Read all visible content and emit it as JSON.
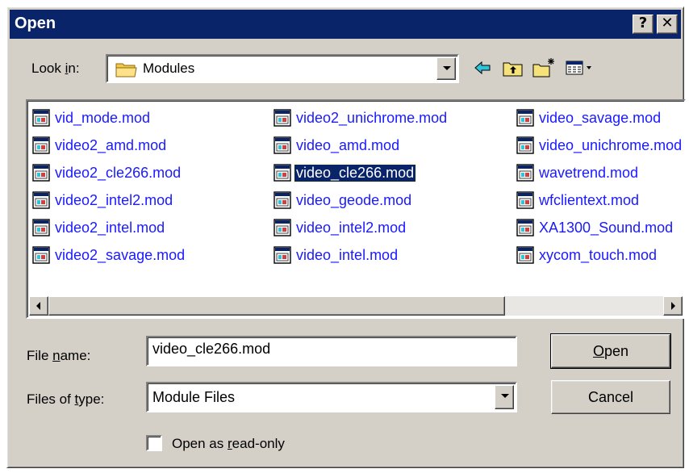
{
  "window": {
    "title": "Open",
    "help_label": "?",
    "close_label": "✕"
  },
  "toolbar": {
    "look_in_pre": "Look ",
    "look_in_key": "i",
    "look_in_post": "n:",
    "current_folder": "Modules",
    "folder_icon": "folder-icon",
    "buttons": [
      "back-arrow-icon",
      "up-folder-icon",
      "new-folder-icon",
      "view-menu-icon"
    ]
  },
  "files": {
    "column1": [
      "vid_mode.mod",
      "video2_amd.mod",
      "video2_cle266.mod",
      "video2_intel2.mod",
      "video2_intel.mod",
      "video2_savage.mod"
    ],
    "column2": [
      "video2_unichrome.mod",
      "video_amd.mod",
      "video_cle266.mod",
      "video_geode.mod",
      "video_intel2.mod",
      "video_intel.mod"
    ],
    "column3": [
      "video_savage.mod",
      "video_unichrome.mod",
      "wavetrend.mod",
      "wfclientext.mod",
      "XA1300_Sound.mod",
      "xycom_touch.mod"
    ],
    "selected": "video_cle266.mod",
    "link_color": "#1a1aff",
    "selection_color": "#0a246a"
  },
  "form": {
    "file_name_pre": "File ",
    "file_name_key": "n",
    "file_name_post": "ame:",
    "file_name_value": "video_cle266.mod",
    "files_of_type_pre": "Files of ",
    "files_of_type_key": "t",
    "files_of_type_post": "ype:",
    "files_of_type_value": "Module Files",
    "readonly_pre": "Open as ",
    "readonly_key": "r",
    "readonly_post": "ead-only",
    "readonly_checked": false
  },
  "buttons": {
    "open_key": "O",
    "open_rest": "pen",
    "cancel": "Cancel"
  }
}
